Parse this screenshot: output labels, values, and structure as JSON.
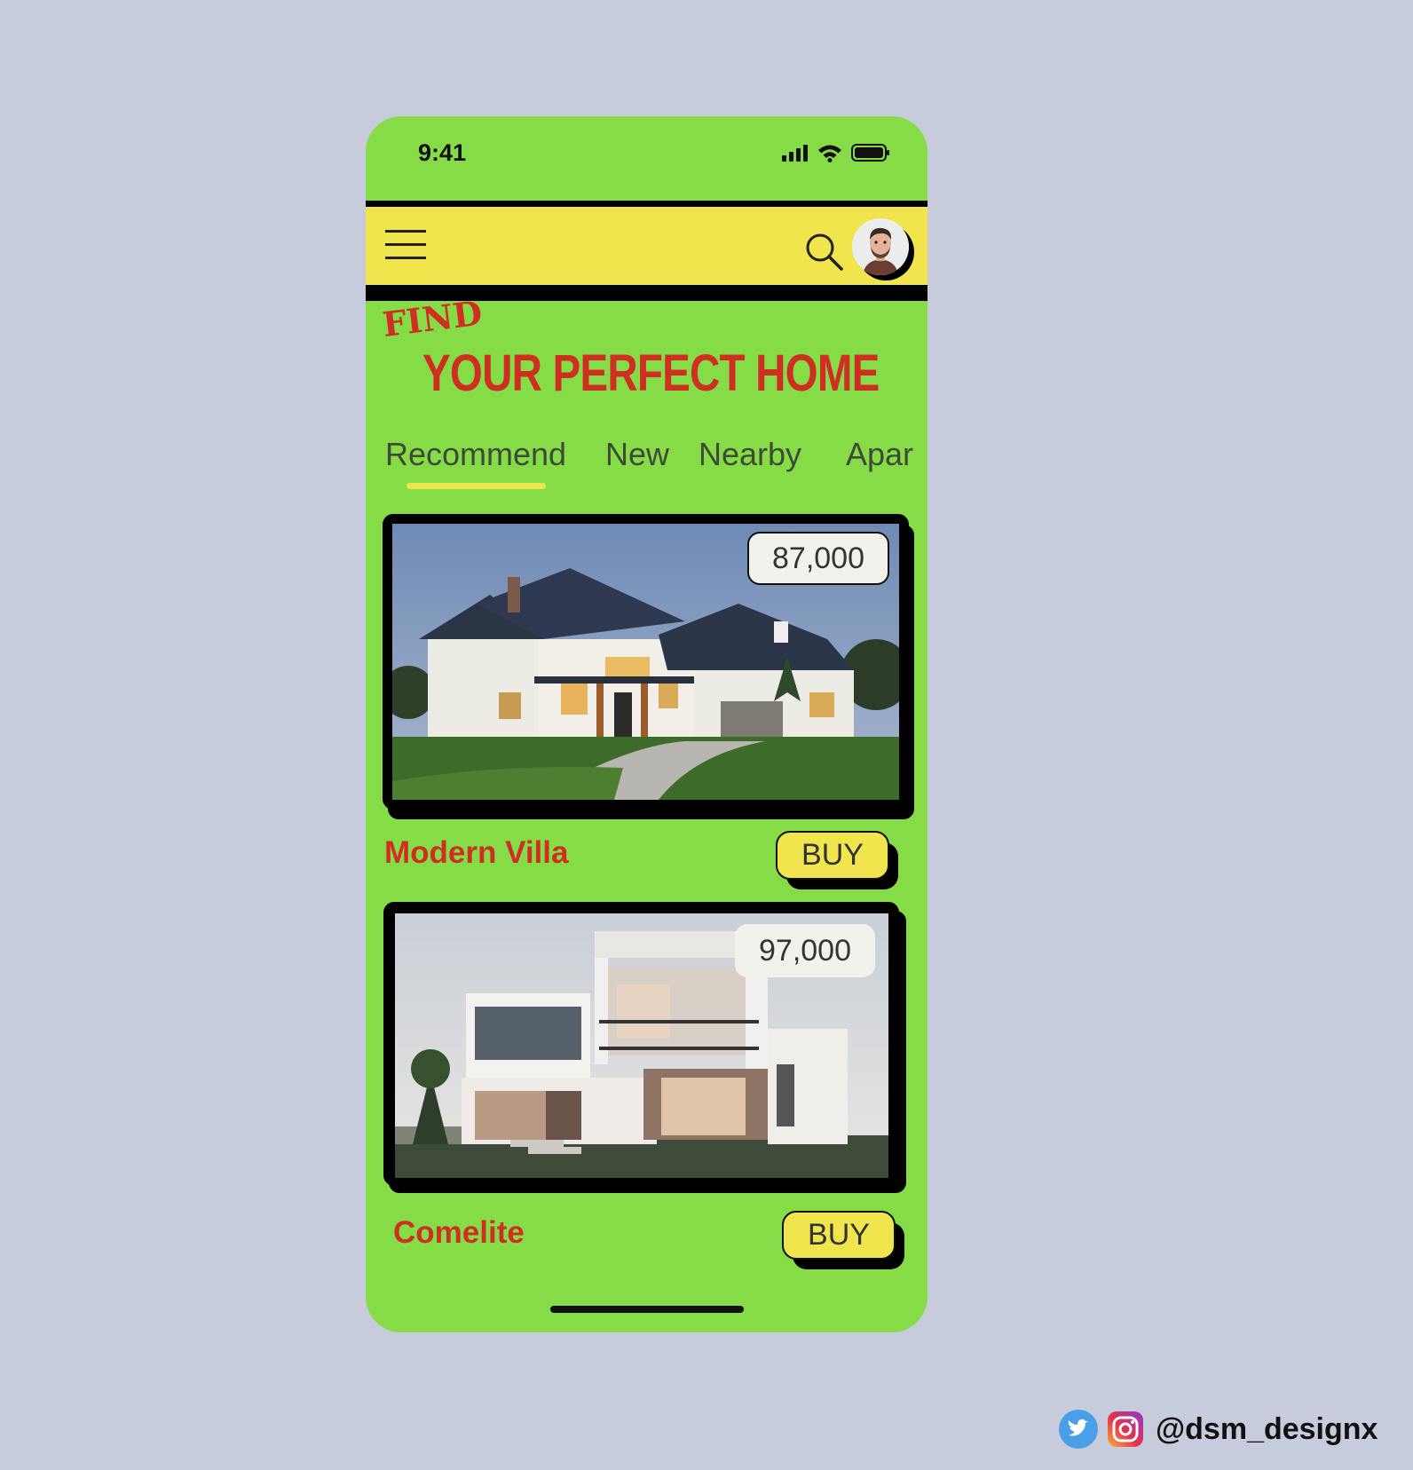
{
  "status_bar": {
    "time": "9:41"
  },
  "header": {
    "menu_icon": "hamburger-menu-icon",
    "search_icon": "search-icon",
    "avatar": "user-avatar"
  },
  "hero": {
    "find": "FIND",
    "title": "YOUR PERFECT HOME"
  },
  "tabs": [
    {
      "label": "Recommend",
      "active": true
    },
    {
      "label": "New",
      "active": false
    },
    {
      "label": "Nearby",
      "active": false
    },
    {
      "label": "Apar",
      "active": false
    }
  ],
  "listings": [
    {
      "name": "Modern Villa",
      "price": "87,000",
      "buy_label": "BUY"
    },
    {
      "name": "Comelite",
      "price": "97,000",
      "buy_label": "BUY"
    }
  ],
  "footer": {
    "handle": "@dsm_designx"
  },
  "colors": {
    "background": "#c6ccdc",
    "phone": "#85dc47",
    "accent_yellow": "#f0e54d",
    "title_red": "#cf2f23"
  }
}
